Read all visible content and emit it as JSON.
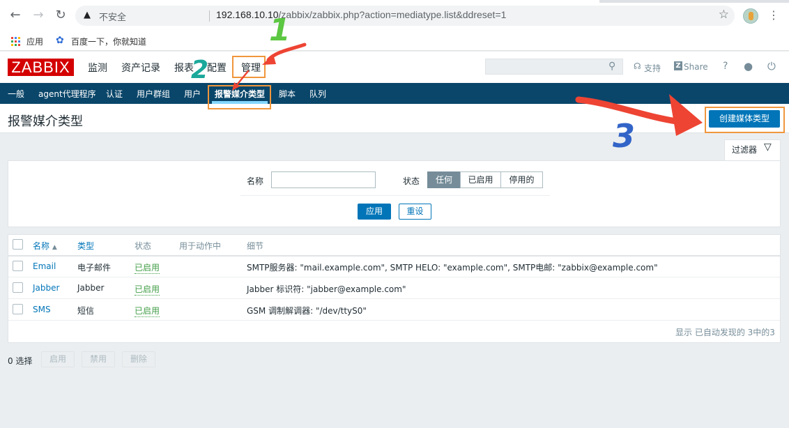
{
  "browser": {
    "insecure_label": "不安全",
    "url_host": "192.168.10.10",
    "url_path": "/zabbix/zabbix.php?action=mediatype.list&ddreset=1",
    "bookmarks": [
      {
        "label": "应用"
      },
      {
        "label": "百度一下，你就知道"
      }
    ]
  },
  "header": {
    "logo": "ZABBIX",
    "menu": [
      "监测",
      "资产记录",
      "报表",
      "配置",
      "管理"
    ],
    "support": "支持",
    "share_logo": "Z",
    "share": "Share",
    "help": "?"
  },
  "sub_menu": [
    "一般",
    "agent代理程序",
    "认证",
    "用户群组",
    "用户",
    "报警媒介类型",
    "脚本",
    "队列"
  ],
  "page": {
    "title": "报警媒介类型",
    "create_button": "创建媒体类型"
  },
  "filter": {
    "tab_label": "过滤器",
    "name_label": "名称",
    "name_value": "",
    "status_label": "状态",
    "status_options": [
      "任何",
      "已启用",
      "停用的"
    ],
    "status_selected": "任何",
    "apply": "应用",
    "reset": "重设"
  },
  "table": {
    "headers": {
      "name": "名称",
      "type": "类型",
      "status": "状态",
      "used_in_actions": "用于动作中",
      "details": "细节"
    },
    "sort_indicator": "▲",
    "rows": [
      {
        "name": "Email",
        "type": "电子邮件",
        "status": "已启用",
        "details": "SMTP服务器: \"mail.example.com\", SMTP HELO: \"example.com\", SMTP电邮: \"zabbix@example.com\""
      },
      {
        "name": "Jabber",
        "type": "Jabber",
        "status": "已启用",
        "details": "Jabber 标识符: \"jabber@example.com\""
      },
      {
        "name": "SMS",
        "type": "短信",
        "status": "已启用",
        "details": "GSM 调制解调器: \"/dev/ttyS0\""
      }
    ],
    "footer": "显示 已自动发现的 3中的3"
  },
  "actions": {
    "selected_count": "0 选择",
    "enable": "启用",
    "disable": "禁用",
    "delete": "删除"
  },
  "annotations": {
    "step1": "1",
    "step2": "2",
    "step3": "3"
  },
  "colors": {
    "brand_red": "#d40000",
    "submenu_bg": "#0a466a",
    "primary_blue": "#0275b8",
    "status_green": "#429e47",
    "annotation_orange": "#f0963c",
    "arrow_red": "#ee4433"
  }
}
